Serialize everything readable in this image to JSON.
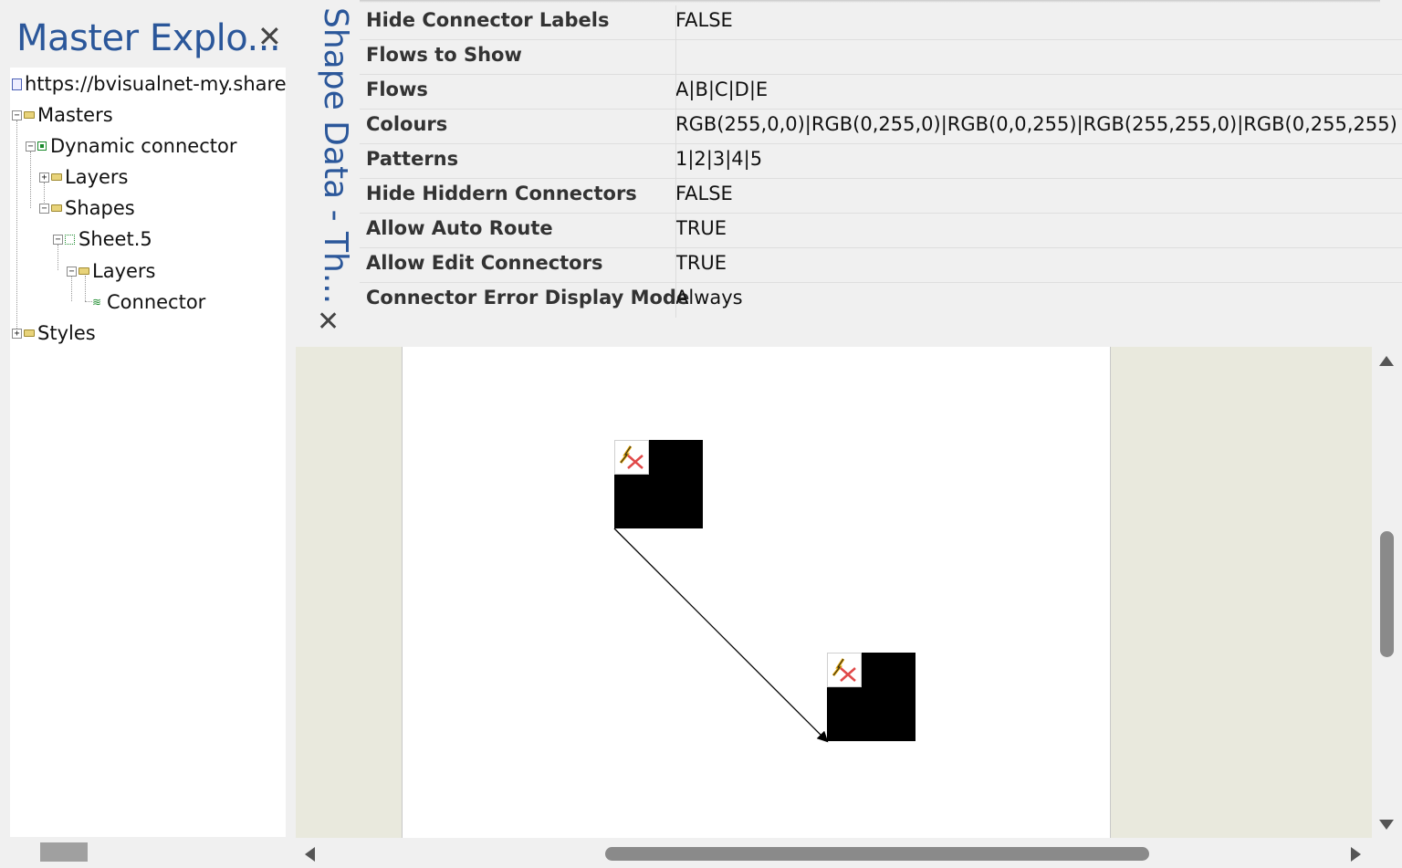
{
  "explorer": {
    "title": "Master Explo...",
    "close_glyph": "✕",
    "tree": [
      {
        "label": "https://bvisualnet-my.share",
        "icon": "document-icon",
        "expander": ""
      },
      {
        "label": "Masters",
        "icon": "folder-icon",
        "expander": "−"
      },
      {
        "label": "Dynamic connector",
        "icon": "master-icon",
        "expander": "−"
      },
      {
        "label": "Layers",
        "icon": "folder-icon",
        "expander": "+"
      },
      {
        "label": "Shapes",
        "icon": "folder-icon",
        "expander": "−"
      },
      {
        "label": "Sheet.5",
        "icon": "sheet-icon",
        "expander": "−"
      },
      {
        "label": "Layers",
        "icon": "folder-icon",
        "expander": "−"
      },
      {
        "label": "Connector",
        "icon": "connector-layer-icon",
        "expander": ""
      },
      {
        "label": "Styles",
        "icon": "folder-icon",
        "expander": "+"
      }
    ]
  },
  "shape_data": {
    "title": "Shape Data - Th...",
    "close_glyph": "✕",
    "rows": [
      {
        "label": "Hide Connector Labels",
        "value": "FALSE"
      },
      {
        "label": "Flows to Show",
        "value": ""
      },
      {
        "label": "Flows",
        "value": "A|B|C|D|E"
      },
      {
        "label": "Colours",
        "value": "RGB(255,0,0)|RGB(0,255,0)|RGB(0,0,255)|RGB(255,255,0)|RGB(0,255,255)"
      },
      {
        "label": "Patterns",
        "value": "1|2|3|4|5"
      },
      {
        "label": "Hide Hiddern Connectors",
        "value": "FALSE"
      },
      {
        "label": "Allow Auto Route",
        "value": "TRUE"
      },
      {
        "label": "Allow Edit Connectors",
        "value": "TRUE"
      },
      {
        "label": "Connector Error Display Mode",
        "value": "Always"
      }
    ]
  },
  "canvas": {
    "background_color": "#e9e9dd",
    "page_color": "#ffffff",
    "shape_color": "#000000"
  },
  "colors": {
    "title_blue": "#2b579a",
    "panel_bg": "#f0f0f0",
    "scroll_thumb": "#8a8a8a"
  }
}
